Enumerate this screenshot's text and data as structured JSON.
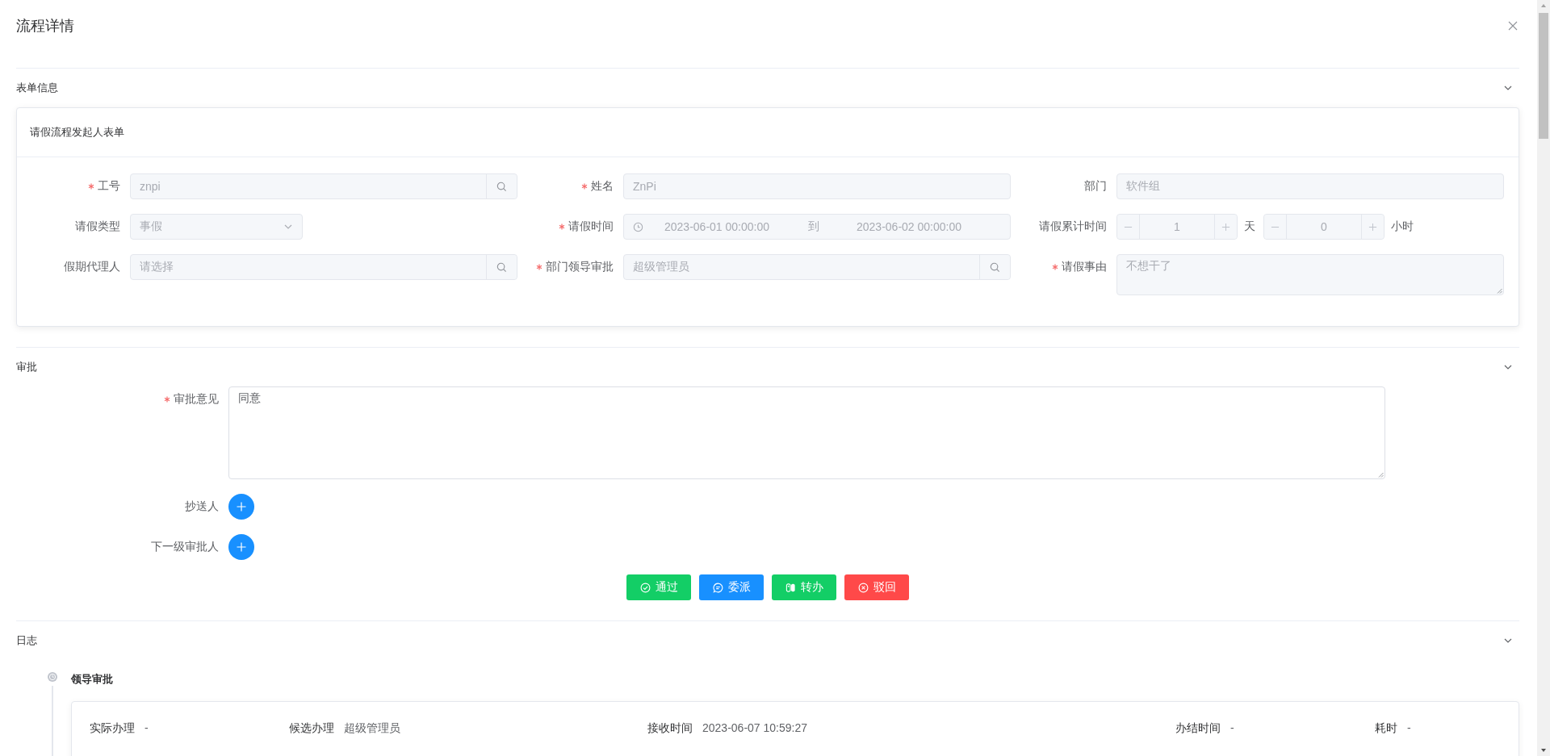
{
  "dialog": {
    "title": "流程详情"
  },
  "form_section": {
    "title": "表单信息",
    "expanded": true,
    "card_title": "请假流程发起人表单",
    "fields": [
      {
        "kind": "search",
        "label": "工号",
        "required": true,
        "disabled": true,
        "value": "znpi"
      },
      {
        "kind": "text",
        "label": "姓名",
        "required": true,
        "disabled": true,
        "value": "ZnPi"
      },
      {
        "kind": "text",
        "label": "部门",
        "required": false,
        "disabled": true,
        "value": "软件组"
      },
      {
        "kind": "select",
        "label": "请假类型",
        "required": false,
        "disabled": true,
        "value": "事假"
      },
      {
        "kind": "daterange",
        "label": "请假时间",
        "required": true,
        "disabled": true,
        "start": "2023-06-01 00:00:00",
        "separator": "到",
        "end": "2023-06-02 00:00:00"
      },
      {
        "kind": "duration",
        "label": "请假累计时间",
        "required": false,
        "disabled": true,
        "parts": [
          {
            "value": "1",
            "unit": "天"
          },
          {
            "value": "0",
            "unit": "小时"
          }
        ]
      },
      {
        "kind": "search",
        "label": "假期代理人",
        "required": false,
        "disabled": true,
        "placeholder": "请选择"
      },
      {
        "kind": "search",
        "label": "部门领导审批",
        "required": true,
        "disabled": true,
        "value": "超级管理员"
      },
      {
        "kind": "textarea",
        "label": "请假事由",
        "required": true,
        "disabled": true,
        "value": "不想干了"
      }
    ]
  },
  "approval_section": {
    "title": "审批",
    "expanded": true,
    "opinion": {
      "label": "审批意见",
      "required": true,
      "disabled": false,
      "value": "同意"
    },
    "pickers": [
      {
        "label": "抄送人"
      },
      {
        "label": "下一级审批人"
      }
    ],
    "actions": [
      {
        "label": "通过",
        "kind": "approve"
      },
      {
        "label": "委派",
        "kind": "delegate"
      },
      {
        "label": "转办",
        "kind": "transfer"
      },
      {
        "label": "驳回",
        "kind": "reject"
      }
    ]
  },
  "log_section": {
    "title": "日志",
    "expanded": true,
    "entries": [
      {
        "title": "领导审批",
        "fields": [
          {
            "label": "实际办理",
            "value": "-"
          },
          {
            "label": "候选办理",
            "value": "超级管理员"
          },
          {
            "label": "接收时间",
            "value": "2023-06-07 10:59:27"
          },
          {
            "label": "办结时间",
            "value": "-"
          },
          {
            "label": "耗时",
            "value": "-"
          }
        ]
      }
    ]
  }
}
